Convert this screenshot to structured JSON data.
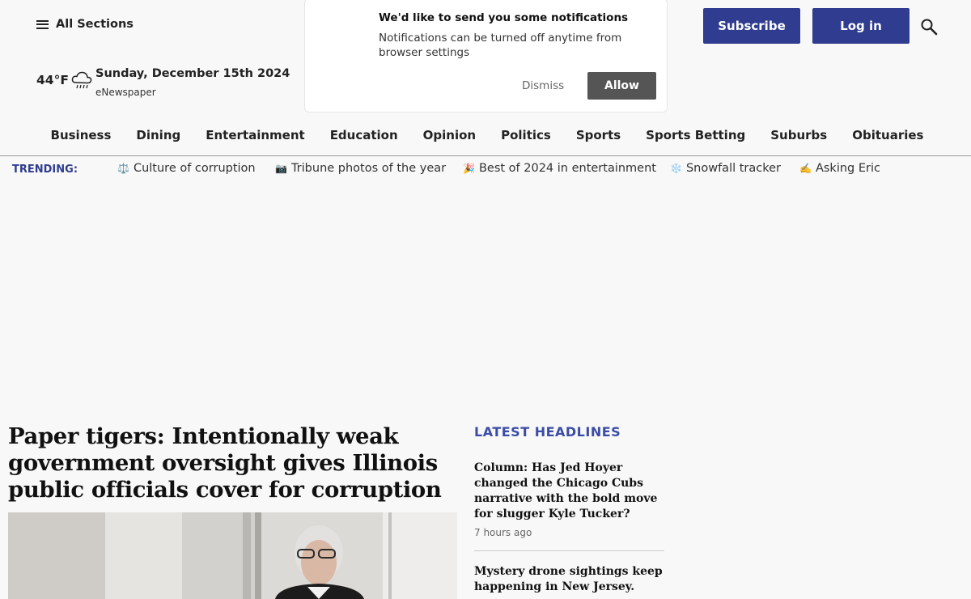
{
  "header": {
    "all_sections": "All Sections",
    "temperature": "44°F",
    "weather_icon": "rain-cloud-icon",
    "date": "Sunday, December 15th 2024",
    "enewspaper": "eNewspaper",
    "subscribe": "Subscribe",
    "login": "Log in",
    "search_icon": "search-icon",
    "accent_color": "#2f3c8f"
  },
  "notification": {
    "title": "We'd like to send you some notifications",
    "body": "Notifications can be turned off anytime from browser settings",
    "dismiss": "Dismiss",
    "allow": "Allow"
  },
  "nav": {
    "items": [
      "Business",
      "Dining",
      "Entertainment",
      "Education",
      "Opinion",
      "Politics",
      "Sports",
      "Sports Betting",
      "Suburbs",
      "Obituaries"
    ]
  },
  "trending": {
    "label": "TRENDING:",
    "items": [
      {
        "emoji": "⚖️",
        "text": "Culture of corruption"
      },
      {
        "emoji": "📷",
        "text": "Tribune photos of the year"
      },
      {
        "emoji": "🎉",
        "text": "Best of 2024 in entertainment"
      },
      {
        "emoji": "❄️",
        "text": "Snowfall tracker"
      },
      {
        "emoji": "✍️",
        "text": "Asking Eric"
      }
    ]
  },
  "main": {
    "headline": "Paper tigers: Intentionally weak government oversight gives Illinois public officials cover for corruption"
  },
  "latest": {
    "title": "LATEST HEADLINES",
    "stories": [
      {
        "title": "Column: Has Jed Hoyer changed the Chicago Cubs narrative with the bold move for slugger Kyle Tucker?",
        "time": "7 hours ago"
      },
      {
        "title": "Mystery drone sightings keep happening in New Jersey.",
        "time": ""
      }
    ]
  }
}
